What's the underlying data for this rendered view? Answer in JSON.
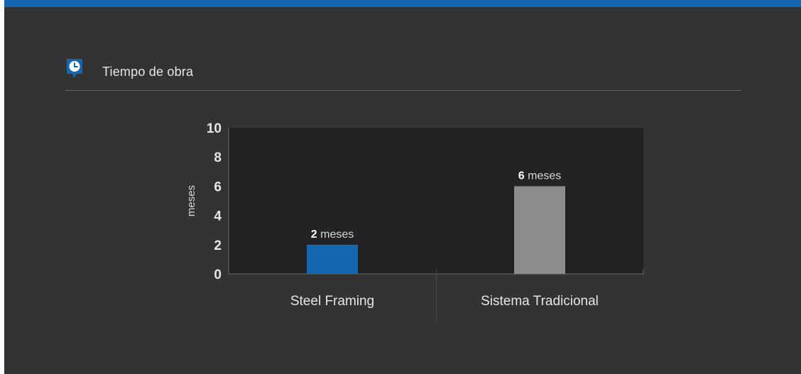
{
  "colors": {
    "background": "#333333",
    "plot_background": "#232325",
    "top_bar": "#1568b0",
    "accent_blue": "#1568b0",
    "bar_gray": "#8c8c8c",
    "text_light": "#e6e6e6"
  },
  "section": {
    "icon": "clock-icon",
    "title": "Tiempo de obra"
  },
  "chart_data": {
    "type": "bar",
    "title": "",
    "xlabel": "",
    "ylabel": "meses",
    "ylim": [
      0,
      10
    ],
    "yticks": [
      0,
      2,
      4,
      6,
      8,
      10
    ],
    "grid": false,
    "categories": [
      "Steel Framing",
      "Sistema Tradicional"
    ],
    "values": [
      2,
      6
    ],
    "bar_colors": [
      "#1568b0",
      "#8c8c8c"
    ],
    "data_labels": [
      {
        "value": "2",
        "unit": "meses"
      },
      {
        "value": "6",
        "unit": "meses"
      }
    ]
  }
}
